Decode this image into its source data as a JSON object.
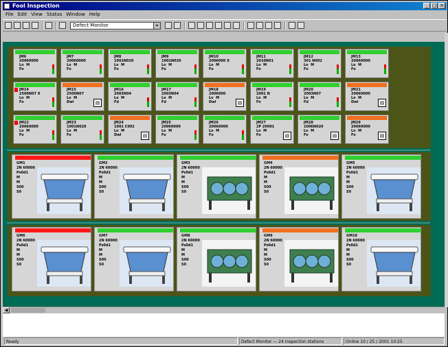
{
  "window": {
    "title": "Fool Inspection",
    "controls": [
      "_",
      "□",
      "×"
    ]
  },
  "menu": {
    "items": [
      "File",
      "Edit",
      "View",
      "Status",
      "Window",
      "Help"
    ]
  },
  "toolbar": {
    "combo_value": "Defect Monitor",
    "combo_arrow": "▾"
  },
  "colors": {
    "client_bg": "#006b55",
    "group_bg": "#4c5418",
    "status_ok": "#2fd02f",
    "status_warn": "#f07020",
    "status_alarm": "#ff1818"
  },
  "small_cards": [
    {
      "status": "ok",
      "flag": false,
      "lines": [
        "JM6",
        "20060000",
        "Lo  M",
        "Fo"
      ],
      "ind": "bar"
    },
    {
      "status": "ok",
      "flag": false,
      "lines": [
        "JM7",
        "20060000",
        "Lo  M",
        "Fo"
      ],
      "ind": "bar"
    },
    {
      "status": "ok",
      "flag": false,
      "lines": [
        "JM8",
        "1001N020",
        "Lo  M",
        "Fo"
      ],
      "ind": "bar"
    },
    {
      "status": "ok",
      "flag": false,
      "lines": [
        "JM9",
        "1001N020",
        "Lo  M",
        "Fo"
      ],
      "ind": "bar"
    },
    {
      "status": "ok",
      "flag": false,
      "lines": [
        "JM10",
        "2006000 X",
        "Lo  M",
        "Fo"
      ],
      "ind": "bar"
    },
    {
      "status": "ok",
      "flag": false,
      "lines": [
        "JM11",
        "2010N01",
        "Lo  M",
        "Fo"
      ],
      "ind": "bar"
    },
    {
      "status": "ok",
      "flag": false,
      "lines": [
        "JM12",
        "301 N002",
        "Lo  M",
        "Fo"
      ],
      "ind": "bar"
    },
    {
      "status": "ok",
      "flag": false,
      "lines": [
        "JM13",
        "20060000",
        "Lo  M",
        "Fo"
      ],
      "ind": "bar"
    },
    {
      "status": "ok",
      "flag": true,
      "lines": [
        "JM14",
        "2500N07 X",
        "Lo  M",
        "Fo"
      ],
      "ind": "bar"
    },
    {
      "status": "warn",
      "flag": false,
      "lines": [
        "JM15",
        "2500N07",
        "Lo  M",
        "Dwl"
      ],
      "ind": "doc"
    },
    {
      "status": "ok",
      "flag": false,
      "lines": [
        "JM16",
        "2003N04",
        "Lo  M",
        "Fd"
      ],
      "ind": "bar"
    },
    {
      "status": "ok",
      "flag": false,
      "lines": [
        "JM17",
        "2003N04",
        "Lo  M",
        "Fd"
      ],
      "ind": "bar"
    },
    {
      "status": "warn",
      "flag": false,
      "lines": [
        "JM18",
        "2006000",
        "Lo  M",
        "Dwl"
      ],
      "ind": "doc"
    },
    {
      "status": "ok",
      "flag": false,
      "lines": [
        "JM19",
        "2001 N",
        "Lo  M",
        "Fo"
      ],
      "ind": "bar"
    },
    {
      "status": "ok",
      "flag": false,
      "lines": [
        "JM20",
        "2003N07",
        "Lo  M",
        "Fd"
      ],
      "ind": "bar"
    },
    {
      "status": "warn",
      "flag": false,
      "lines": [
        "JM21",
        "20060000",
        "Lo  M",
        "Dwl"
      ],
      "ind": "doc"
    },
    {
      "status": "ok",
      "flag": true,
      "lines": [
        "JM22",
        "20060000",
        "Lo  M",
        "Fo"
      ],
      "ind": "bar"
    },
    {
      "status": "ok",
      "flag": false,
      "lines": [
        "JM23",
        "1001N020",
        "Lo  M",
        "Fo"
      ],
      "ind": "bar"
    },
    {
      "status": "warn",
      "flag": false,
      "lines": [
        "JM24",
        "1001 C002",
        "Lo  M",
        "Dwl"
      ],
      "ind": "doc"
    },
    {
      "status": "ok",
      "flag": false,
      "lines": [
        "JM25",
        "20060000",
        "Lo  M",
        "Fo"
      ],
      "ind": "bar"
    },
    {
      "status": "ok",
      "flag": false,
      "lines": [
        "JM26",
        "20060000",
        "Lo  M",
        "Fo"
      ],
      "ind": "bar"
    },
    {
      "status": "ok",
      "flag": false,
      "lines": [
        "JM27",
        "2P 20001",
        "Lo  M",
        "Fo"
      ],
      "ind": "doc"
    },
    {
      "status": "ok",
      "flag": false,
      "lines": [
        "JM28",
        "1006N020",
        "Lo  M",
        "Fo"
      ],
      "ind": "doc"
    },
    {
      "status": "warn",
      "flag": false,
      "lines": [
        "JM29",
        "20060000",
        "Lo  M",
        "Fo"
      ],
      "ind": "doc"
    }
  ],
  "big_cards_row1": [
    {
      "status": "alarm",
      "machine": "white",
      "lines": [
        "GM1",
        "2N 60000",
        "Ps0d1",
        "M",
        "M",
        "S00",
        "S0"
      ]
    },
    {
      "status": "ok",
      "machine": "white",
      "lines": [
        "GM2",
        "2N 60000",
        "Ps0d1",
        "M",
        "M",
        "S00",
        "S0"
      ]
    },
    {
      "status": "ok",
      "machine": "green",
      "lines": [
        "GM3",
        "2N 60000",
        "Ps0d1",
        "M",
        "M",
        "S00",
        "S0"
      ]
    },
    {
      "status": "warn",
      "machine": "green",
      "lines": [
        "GM4",
        "2N 60000",
        "Ps0d1",
        "M",
        "M",
        "S00",
        "S0"
      ]
    },
    {
      "status": "ok",
      "machine": "white",
      "lines": [
        "GM5",
        "2N 60000",
        "Ps0d1",
        "M",
        "M",
        "S00",
        "S0"
      ]
    }
  ],
  "big_cards_row2": [
    {
      "status": "alarm",
      "machine": "white",
      "lines": [
        "GM6",
        "2N 60000",
        "Ps0d1",
        "M",
        "M",
        "S00",
        "S0"
      ]
    },
    {
      "status": "ok",
      "machine": "white",
      "lines": [
        "GM7",
        "2N 60000",
        "Ps0d1",
        "M",
        "M",
        "S00",
        "S0"
      ]
    },
    {
      "status": "ok",
      "machine": "green",
      "lines": [
        "GM8",
        "2N 60000",
        "Ps0d1",
        "M",
        "M",
        "S00",
        "S0"
      ]
    },
    {
      "status": "warn",
      "machine": "green",
      "lines": [
        "GM9",
        "2N 60000",
        "Ps0d1",
        "M",
        "M",
        "S00",
        "S0"
      ]
    },
    {
      "status": "ok",
      "machine": "white",
      "lines": [
        "GM10",
        "2N 60000",
        "Ps0d1",
        "M",
        "M",
        "S00",
        "S0"
      ]
    }
  ],
  "statusbar": {
    "left": "Ready",
    "middle": "Defect Monitor  — 24 inspection stations",
    "right": "Online  10 / 25 / 2001  10:25"
  }
}
